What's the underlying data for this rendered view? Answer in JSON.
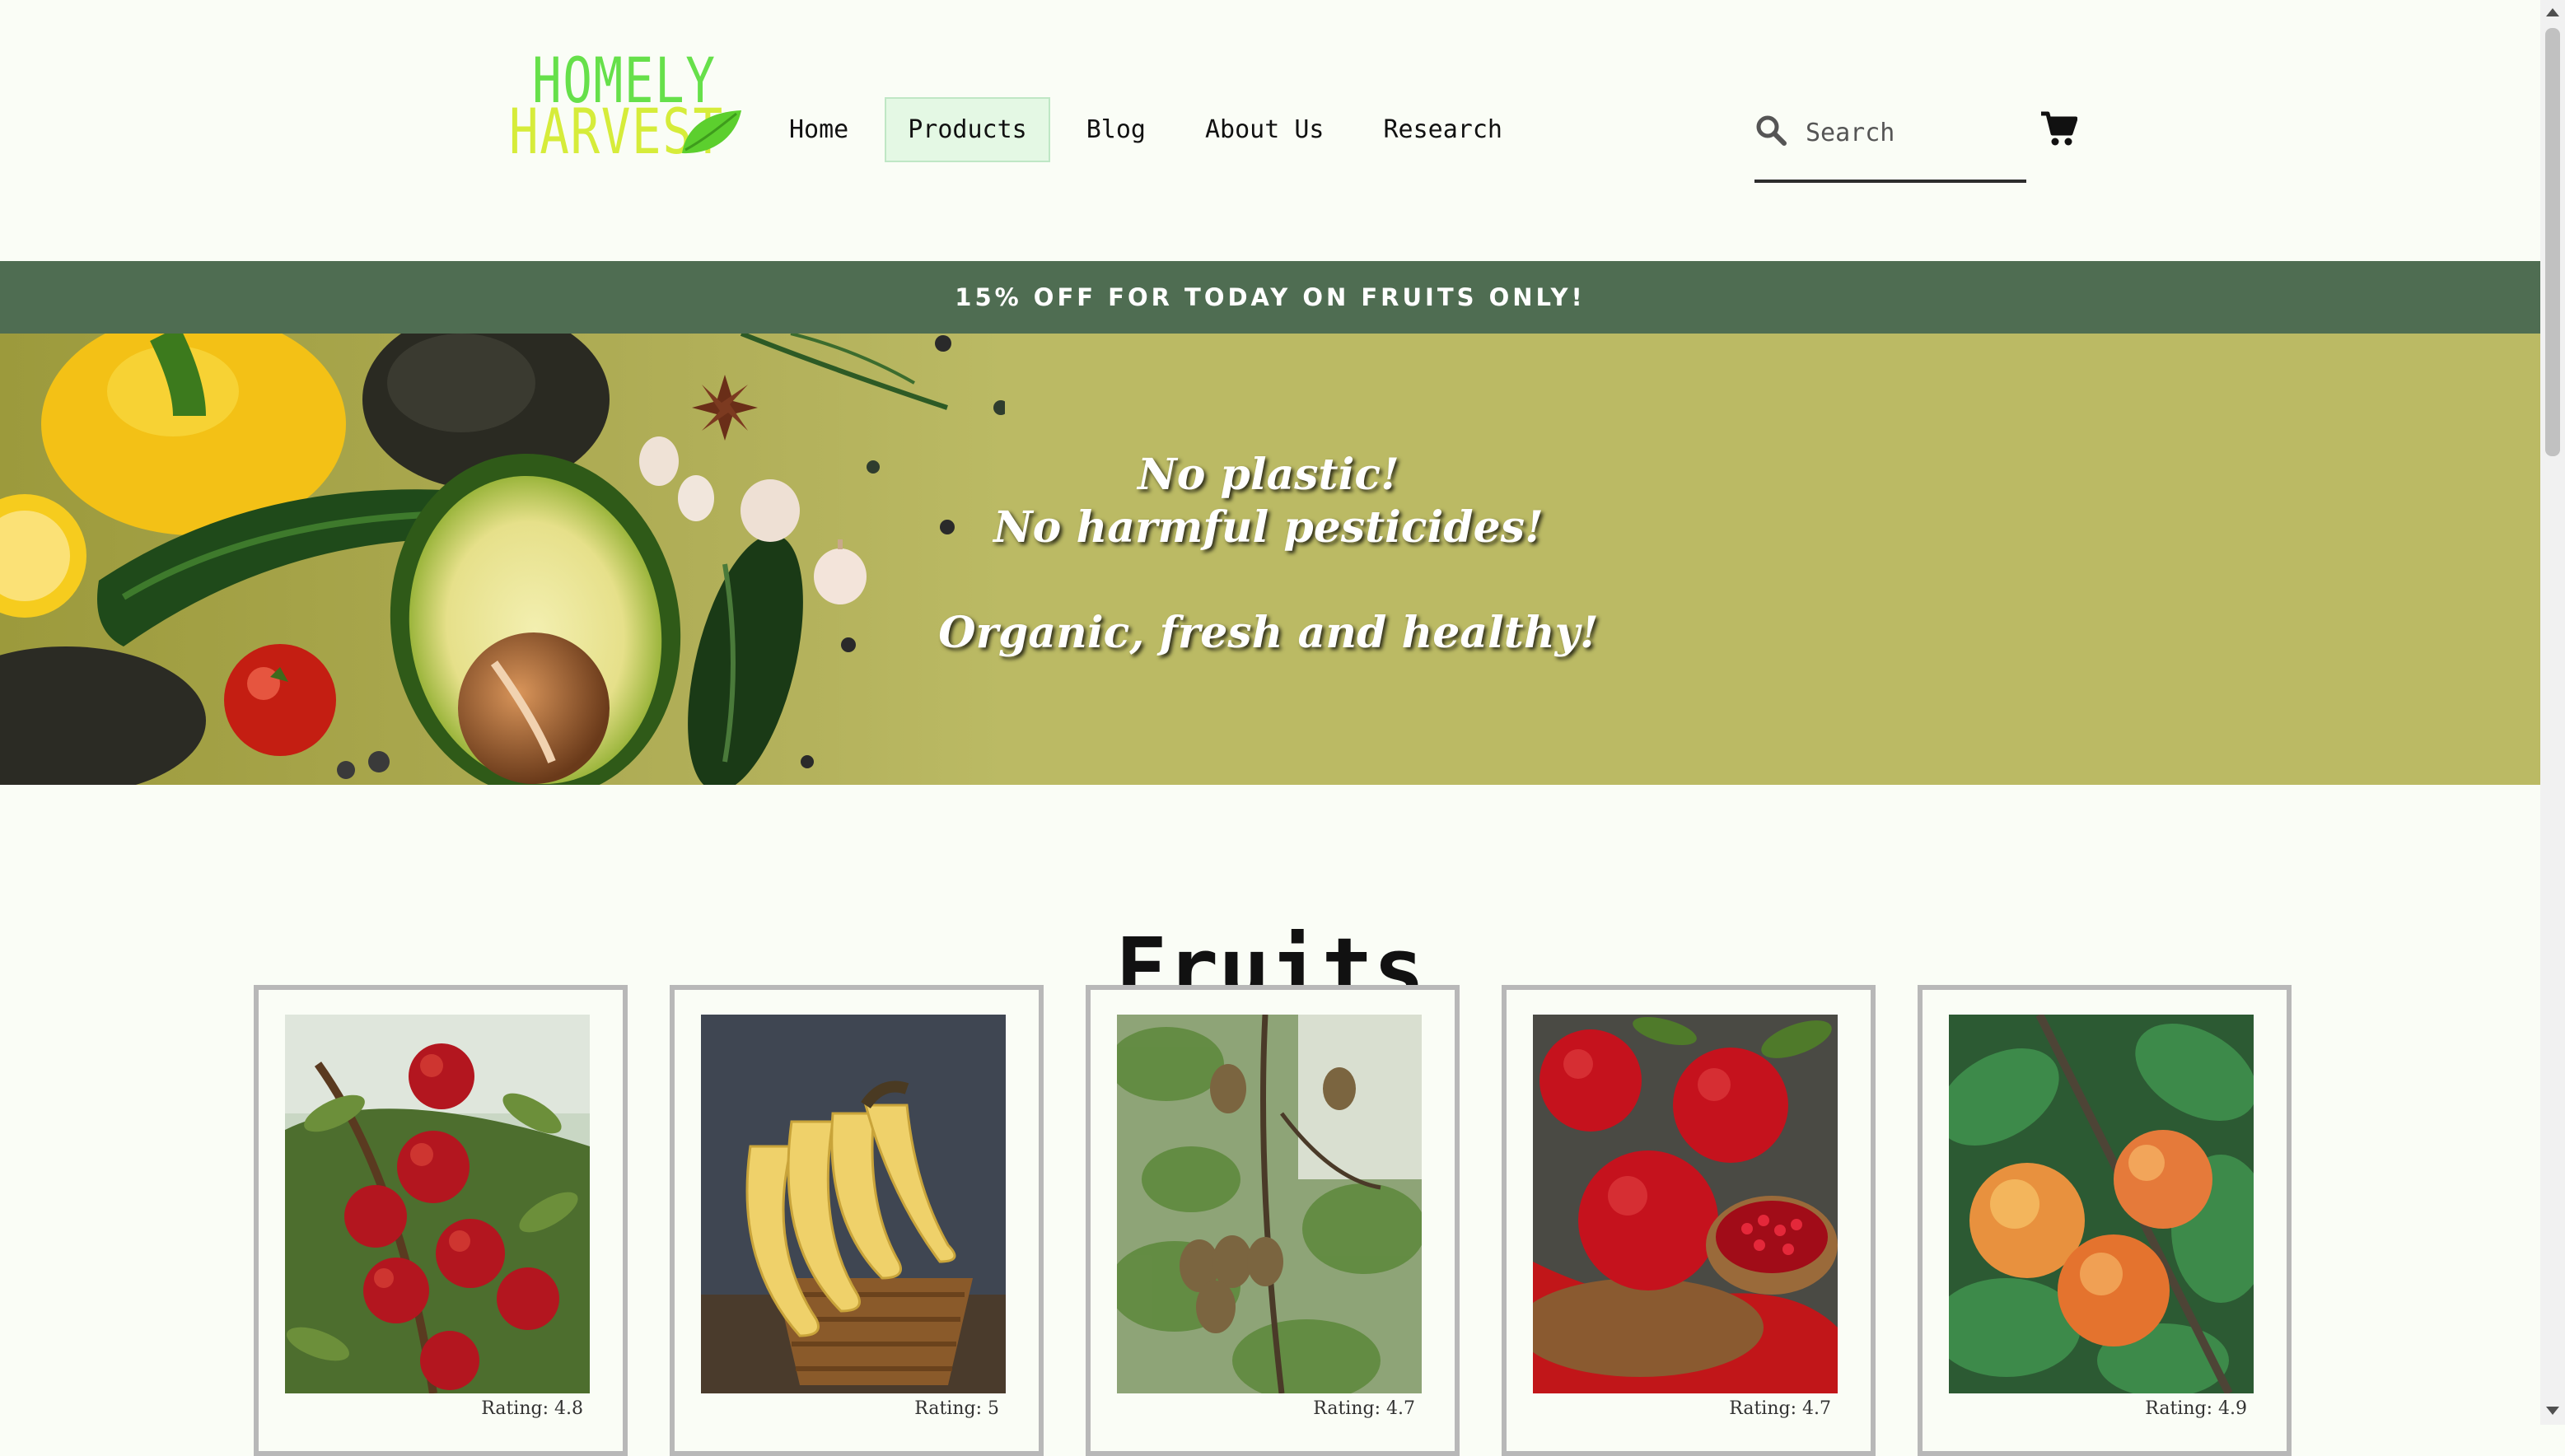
{
  "logo": {
    "line1": "HOMELY",
    "line2": "HARVEST"
  },
  "nav": {
    "items": [
      {
        "label": "Home"
      },
      {
        "label": "Products",
        "active": true
      },
      {
        "label": "Blog"
      },
      {
        "label": "About Us"
      },
      {
        "label": "Research"
      }
    ]
  },
  "search": {
    "placeholder": "Search",
    "value": ""
  },
  "icons": {
    "search": "search-icon",
    "cart": "cart-icon"
  },
  "promo": {
    "text": "15% OFF FOR TODAY ON FRUITS ONLY!"
  },
  "hero": {
    "line1": "No plastic!",
    "line2": "No harmful pesticides!",
    "line3": "Organic, fresh and healthy!"
  },
  "section": {
    "title": "Fruits"
  },
  "products": [
    {
      "image": "apples-photo",
      "rating": "Rating: 4.8"
    },
    {
      "image": "bananas-photo",
      "rating": "Rating: 5"
    },
    {
      "image": "kiwi-photo",
      "rating": "Rating: 4.7"
    },
    {
      "image": "pomegranate-photo",
      "rating": "Rating: 4.7"
    },
    {
      "image": "apricots-photo",
      "rating": "Rating: 4.9"
    }
  ],
  "colors": {
    "background": "#fafdf6",
    "promo_bar": "#4f6d52",
    "hero_bg": "#bbba64",
    "logo_green": "#66e04a",
    "logo_yellow": "#d6ec3a",
    "nav_active_bg": "#e4f8e4"
  }
}
